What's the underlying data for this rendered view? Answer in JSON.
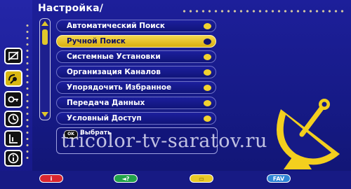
{
  "header": {
    "title": "Настройка/"
  },
  "menu": {
    "items": [
      {
        "label": "Автоматический Поиск",
        "selected": false
      },
      {
        "label": "Ручной Поиск",
        "selected": true
      },
      {
        "label": "Системные Установки",
        "selected": false
      },
      {
        "label": "Организация Каналов",
        "selected": false
      },
      {
        "label": "Упорядочить Избранное",
        "selected": false
      },
      {
        "label": "Передача Данных",
        "selected": false
      },
      {
        "label": "Условный Доступ",
        "selected": false
      }
    ]
  },
  "hint": {
    "key": "OK",
    "label": "Выбрать"
  },
  "watermark": "tricolor-tv-saratov.ru",
  "sidebar": {
    "icons": [
      "tv-crossed-icon",
      "satellite-settings-icon",
      "key-icon",
      "clock-icon",
      "chart-icon",
      "info-icon"
    ],
    "active_index": 1
  },
  "function_keys": [
    {
      "name": "info-key",
      "label": "i",
      "color": "#d9262f"
    },
    {
      "name": "help-key",
      "label": "◄?",
      "color": "#22a34a"
    },
    {
      "name": "yellow-key",
      "label": "▭",
      "color": "#e8c927"
    },
    {
      "name": "fav-key",
      "label": "FAV",
      "color": "#2f86d6"
    }
  ],
  "colors": {
    "background": "#1a1c96",
    "accent": "#f2d230",
    "text": "#ffffff"
  }
}
